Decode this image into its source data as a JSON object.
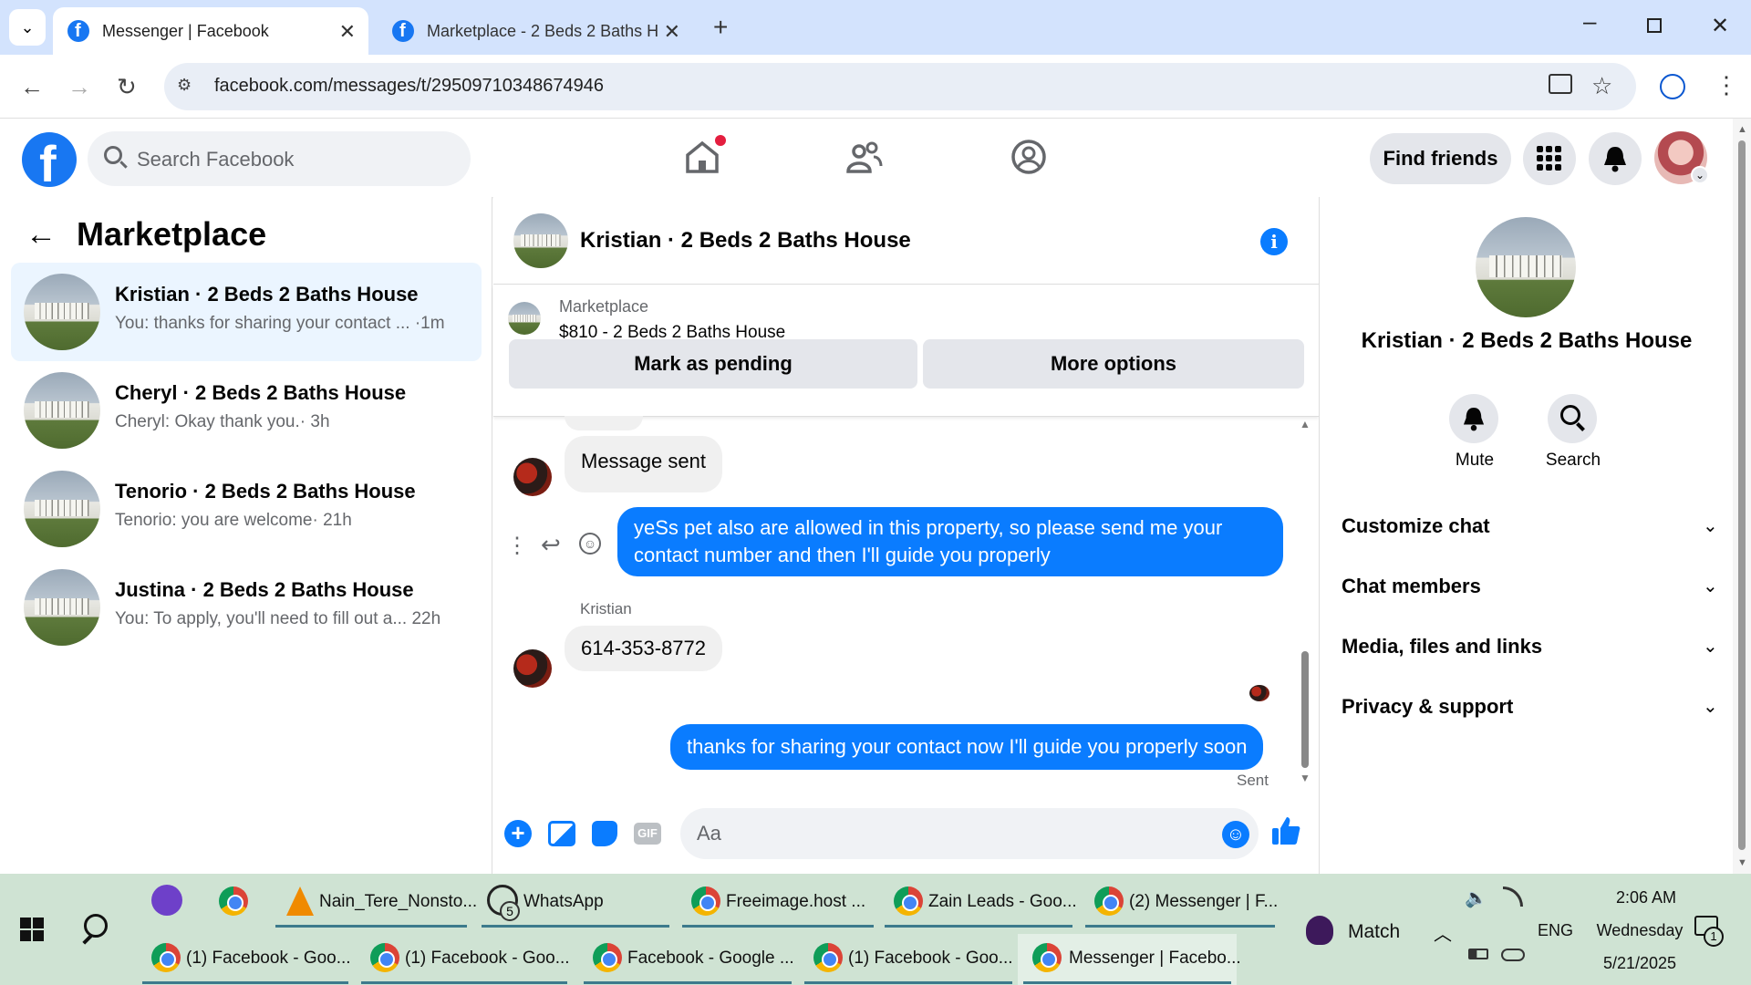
{
  "browser": {
    "tabs": [
      {
        "title": "Messenger | Facebook",
        "active": true
      },
      {
        "title": "Marketplace - 2 Beds 2 Baths H",
        "active": false
      }
    ],
    "url": "facebook.com/messages/t/29509710348674946"
  },
  "fb": {
    "search_placeholder": "Search Facebook",
    "find_friends": "Find friends"
  },
  "left": {
    "title": "Marketplace",
    "conversations": [
      {
        "name": "Kristian · 2 Beds 2 Baths House",
        "snippet": "You: thanks for sharing your contact ...",
        "time": "·1m",
        "selected": true
      },
      {
        "name": "Cheryl · 2 Beds 2 Baths House",
        "snippet": "Cheryl: Okay thank you.",
        "time": "· 3h",
        "selected": false
      },
      {
        "name": "Tenorio · 2 Beds 2 Baths House",
        "snippet": "Tenorio: you are welcome",
        "time": "· 21h",
        "selected": false
      },
      {
        "name": "Justina · 2 Beds 2 Baths House",
        "snippet": "You: To apply, you'll need to fill out a...",
        "time": "22h",
        "selected": false
      }
    ]
  },
  "chat": {
    "title": "Kristian · 2 Beds 2 Baths House",
    "listing_label": "Marketplace",
    "listing_title": "$810 - 2 Beds 2 Baths House",
    "mark_pending": "Mark as pending",
    "more_options": "More options",
    "messages": {
      "m1": "Message sent",
      "m2": "yeSs pet also are allowed in this property, so please send me your contact number and then I'll guide you properly",
      "sender": "Kristian",
      "m3": "614-353-8772",
      "m4": "thanks for sharing your contact now I'll guide you properly soon",
      "status": "Sent"
    },
    "composer_placeholder": "Aa"
  },
  "right": {
    "name": "Kristian · 2 Beds 2 Baths House",
    "mute": "Mute",
    "search": "Search",
    "sections": [
      "Customize chat",
      "Chat members",
      "Media, files and links",
      "Privacy & support"
    ]
  },
  "taskbar": {
    "row1": [
      "Nain_Tere_Nonsto...",
      "WhatsApp",
      "Freeimage.host ...",
      "Zain Leads - Goo...",
      "(2) Messenger | F..."
    ],
    "row2": [
      "(1) Facebook - Goo...",
      "(1) Facebook - Goo...",
      "Facebook - Google ...",
      "(1) Facebook - Goo...",
      "Messenger | Facebo..."
    ],
    "whatsapp_badge": "5",
    "match": "Match",
    "lang": "ENG",
    "time": "2:06 AM",
    "day": "Wednesday",
    "date": "5/21/2025",
    "notif_badge": "1"
  },
  "colors": {
    "fb_blue": "#1877f2",
    "messenger_blue": "#0a7cff",
    "selected_row": "#ebf5ff"
  }
}
